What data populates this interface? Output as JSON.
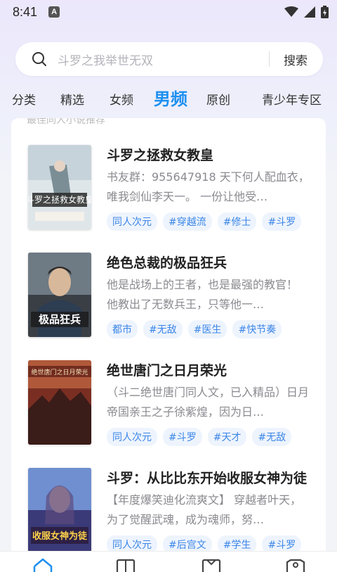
{
  "status_bar": {
    "time": "8:41",
    "notification_badge": "A"
  },
  "search": {
    "placeholder": "斗罗之我举世无双",
    "button_label": "搜索"
  },
  "tabs": [
    {
      "label": "分类"
    },
    {
      "label": "精选"
    },
    {
      "label": "女频"
    },
    {
      "label": "男频",
      "active": true
    },
    {
      "label": "原创"
    },
    {
      "label": "青少年专区"
    }
  ],
  "section_title": "最佳同人小说推荐",
  "books": [
    {
      "title": "斗罗之拯救女教皇",
      "description": "书友群：955647918 天下何人配血衣，唯我剑仙李天一。 一份让他受…",
      "tags": [
        "同人次元",
        "#穿越流",
        "#修士",
        "#斗罗"
      ],
      "cover_text": "斗罗之拯救女教皇"
    },
    {
      "title": "绝色总裁的极品狂兵",
      "description": "他是战场上的王者，也是最强的教官！ 他教出了无数兵王，只等他一…",
      "tags": [
        "都市",
        "#无敌",
        "#医生",
        "#快节奏"
      ],
      "cover_text": "极品狂兵"
    },
    {
      "title": "绝世唐门之日月荣光",
      "description": "（斗二绝世唐门同人文，已入精品）日月帝国亲王之子徐紫煌，因为日…",
      "tags": [
        "同人次元",
        "#斗罗",
        "#天才",
        "#无敌"
      ],
      "cover_text": "绝世唐门之日月荣光"
    },
    {
      "title": "斗罗：从比比东开始收服女神为徒",
      "description": "【年度爆笑迪化流爽文】 穿越者叶天，为了觉醒武魂，成为魂师，努…",
      "tags": [
        "同人次元",
        "#后宫文",
        "#学生",
        "#斗罗"
      ],
      "cover_text": "收服女神为徒"
    }
  ],
  "colors": {
    "accent": "#1e90f0",
    "tag_text": "#3b86e8",
    "tag_bg": "#eef4fd"
  }
}
